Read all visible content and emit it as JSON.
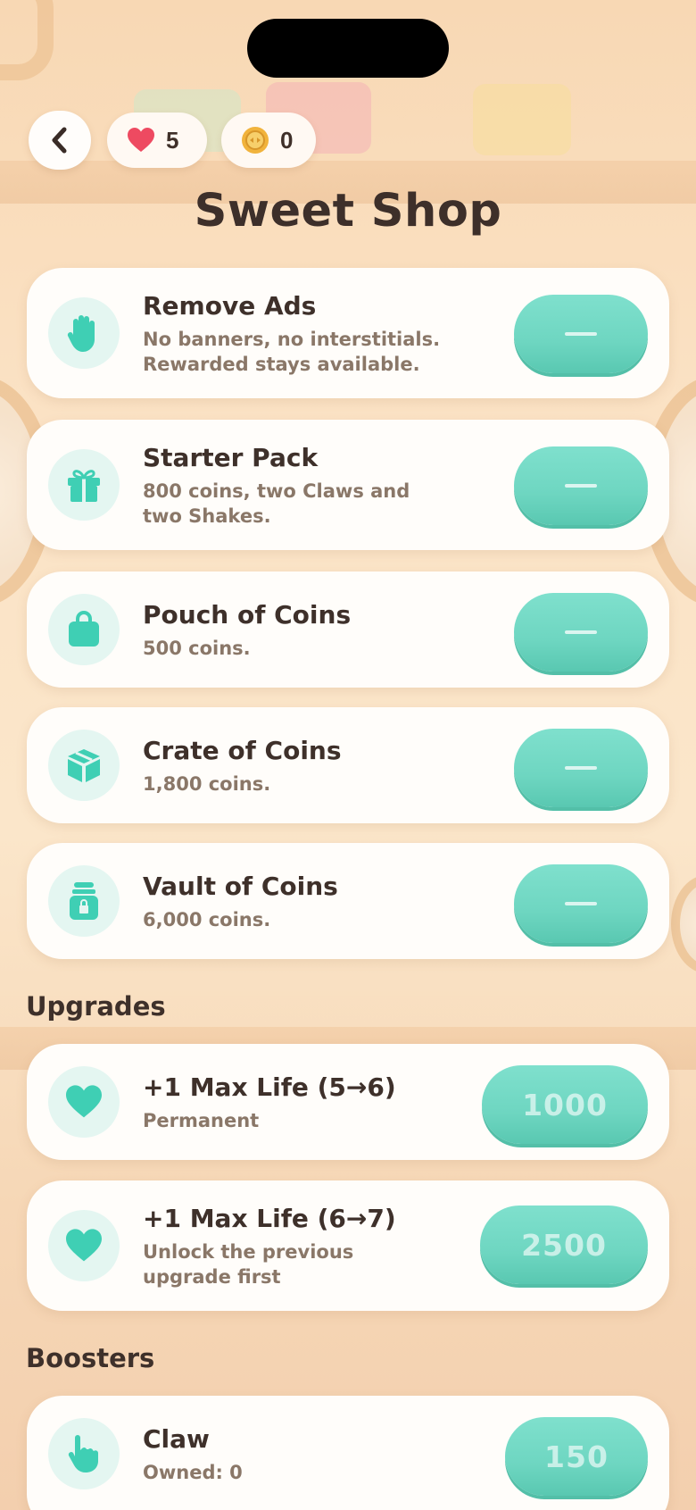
{
  "header": {
    "hearts": "5",
    "coins": "0",
    "title": "Sweet Shop"
  },
  "shop": [
    {
      "title": "Remove Ads",
      "desc": [
        "No banners, no interstitials.",
        "Rewarded stays available."
      ],
      "icon": "hand-icon",
      "button": "—"
    },
    {
      "title": "Starter Pack",
      "desc": [
        "800 coins, two Claws and",
        "two Shakes."
      ],
      "icon": "gift-icon",
      "button": "—"
    },
    {
      "title": "Pouch of Coins",
      "desc": [
        "500 coins."
      ],
      "icon": "bag-icon",
      "button": "—"
    },
    {
      "title": "Crate of Coins",
      "desc": [
        "1,800 coins."
      ],
      "icon": "box-icon",
      "button": "—"
    },
    {
      "title": "Vault of Coins",
      "desc": [
        "6,000 coins."
      ],
      "icon": "vault-jar-icon",
      "button": "—"
    }
  ],
  "sections": {
    "upgrades": "Upgrades",
    "boosters": "Boosters"
  },
  "upgrades": [
    {
      "title": "+1 Max Life (5→6)",
      "desc": [
        "Permanent"
      ],
      "icon": "heart-icon",
      "price": "1000"
    },
    {
      "title": "+1 Max Life (6→7)",
      "desc": [
        "Unlock the previous",
        "upgrade first"
      ],
      "icon": "heart-icon",
      "price": "2500"
    }
  ],
  "boosters": [
    {
      "title": "Claw",
      "desc": [
        "Owned: 0"
      ],
      "icon": "pointer-hand-icon",
      "price": "150"
    }
  ],
  "colors": {
    "accent": "#6ed6c1",
    "icon": "#3fcfb4",
    "heart_red": "#ee4a61",
    "coin_gold": "#f1b33c"
  }
}
